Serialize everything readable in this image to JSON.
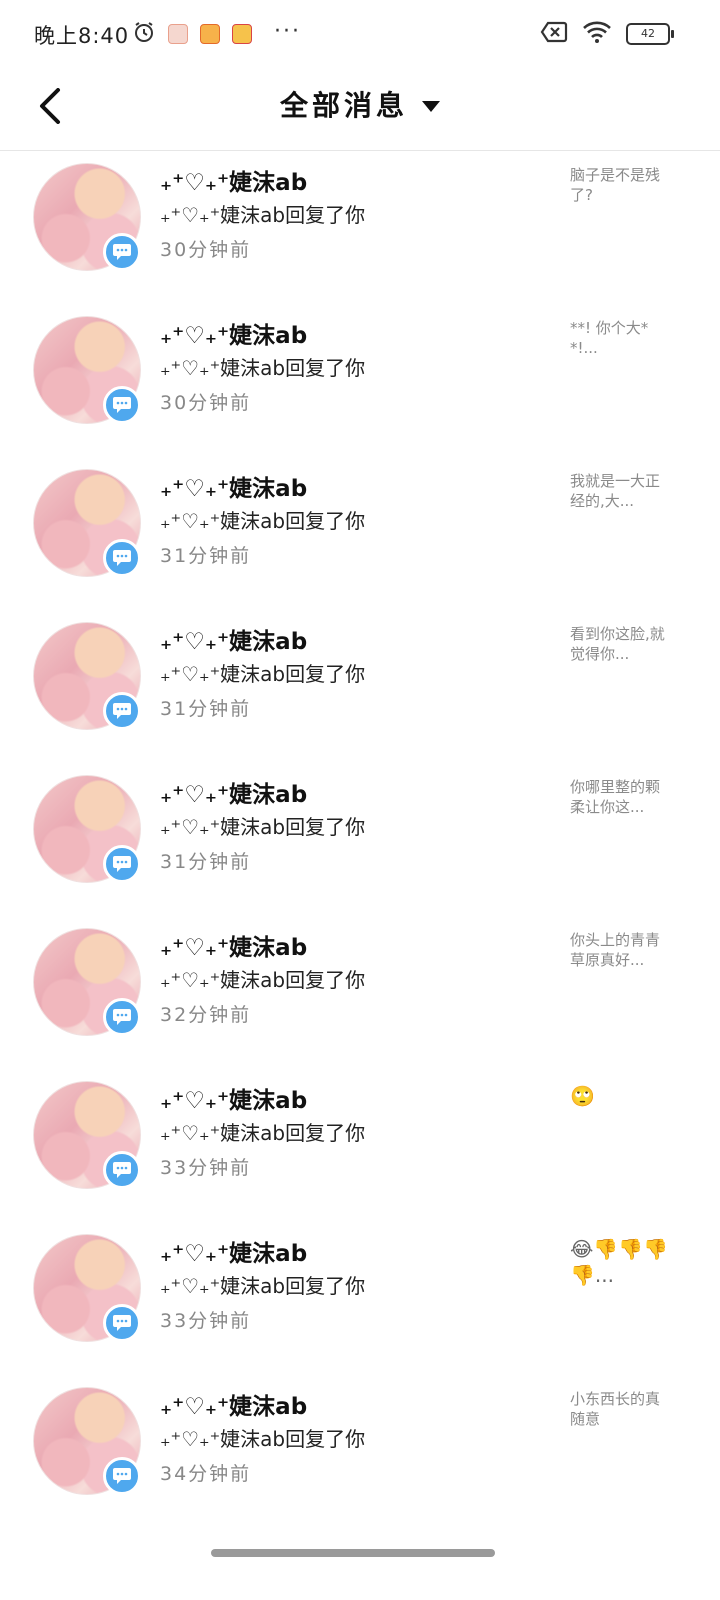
{
  "status_bar": {
    "time": "晚上8:40",
    "more": "···",
    "battery": "42"
  },
  "header": {
    "title": "全部消息"
  },
  "items": [
    {
      "sender": "₊⁺♡₊⁺婕沫ab",
      "reply": "₊⁺♡₊⁺婕沫ab回复了你",
      "time": "30分钟前",
      "preview": "脑子是不是残了?"
    },
    {
      "sender": "₊⁺♡₊⁺婕沫ab",
      "reply": "₊⁺♡₊⁺婕沫ab回复了你",
      "time": "30分钟前",
      "preview": "**! 你个大**!..."
    },
    {
      "sender": "₊⁺♡₊⁺婕沫ab",
      "reply": "₊⁺♡₊⁺婕沫ab回复了你",
      "time": "31分钟前",
      "preview": "我就是一大正经的,大..."
    },
    {
      "sender": "₊⁺♡₊⁺婕沫ab",
      "reply": "₊⁺♡₊⁺婕沫ab回复了你",
      "time": "31分钟前",
      "preview": "看到你这脸,就觉得你..."
    },
    {
      "sender": "₊⁺♡₊⁺婕沫ab",
      "reply": "₊⁺♡₊⁺婕沫ab回复了你",
      "time": "31分钟前",
      "preview": "你哪里整的颗柔让你这..."
    },
    {
      "sender": "₊⁺♡₊⁺婕沫ab",
      "reply": "₊⁺♡₊⁺婕沫ab回复了你",
      "time": "32分钟前",
      "preview": "你头上的青青草原真好..."
    },
    {
      "sender": "₊⁺♡₊⁺婕沫ab",
      "reply": "₊⁺♡₊⁺婕沫ab回复了你",
      "time": "33分钟前",
      "preview": "🙄",
      "emoji": true
    },
    {
      "sender": "₊⁺♡₊⁺婕沫ab",
      "reply": "₊⁺♡₊⁺婕沫ab回复了你",
      "time": "33分钟前",
      "preview": "😂👎👎👎👎...",
      "emoji": true
    },
    {
      "sender": "₊⁺♡₊⁺婕沫ab",
      "reply": "₊⁺♡₊⁺婕沫ab回复了你",
      "time": "34分钟前",
      "preview": "小东西长的真随意"
    }
  ],
  "colors": {
    "badge": "#4fa8ee",
    "secondary_text": "#888888"
  },
  "icons": {
    "back": "chevron-left-icon",
    "dropdown": "caret-down-icon",
    "badge": "chat-bubble-icon"
  }
}
